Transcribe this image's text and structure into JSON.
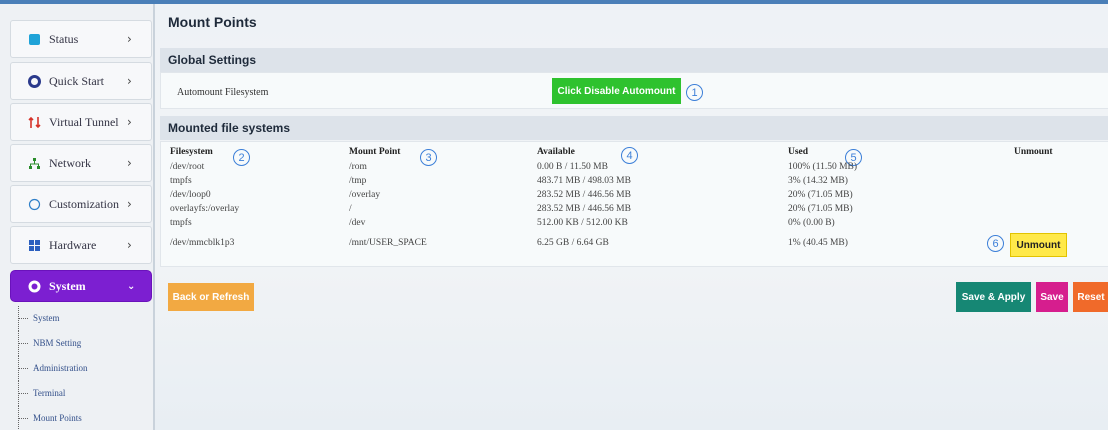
{
  "sidebar": {
    "items": [
      {
        "label": "Status",
        "icon": "status-icon"
      },
      {
        "label": "Quick Start",
        "icon": "gear-icon"
      },
      {
        "label": "Virtual Tunnel",
        "icon": "tunnel-icon"
      },
      {
        "label": "Network",
        "icon": "network-icon"
      },
      {
        "label": "Customization",
        "icon": "customization-icon"
      },
      {
        "label": "Hardware",
        "icon": "hardware-icon"
      },
      {
        "label": "System",
        "icon": "system-gear-icon"
      }
    ],
    "submenu": [
      "System",
      "NBM Setting",
      "Administration",
      "Terminal",
      "Mount Points"
    ]
  },
  "main": {
    "title": "Mount Points",
    "global_settings": {
      "header": "Global Settings",
      "automount_label": "Automount Filesystem",
      "automount_button": "Click Disable Automount"
    },
    "mounted": {
      "header": "Mounted file systems",
      "columns": [
        "Filesystem",
        "Mount Point",
        "Available",
        "Used",
        "Unmount"
      ],
      "rows": [
        [
          "/dev/root",
          "/rom",
          "0.00 B / 11.50 MB",
          "100% (11.50 MB)"
        ],
        [
          "tmpfs",
          "/tmp",
          "483.71 MB / 498.03 MB",
          "3% (14.32 MB)"
        ],
        [
          "/dev/loop0",
          "/overlay",
          "283.52 MB / 446.56 MB",
          "20% (71.05 MB)"
        ],
        [
          "overlayfs:/overlay",
          "/",
          "283.52 MB / 446.56 MB",
          "20% (71.05 MB)"
        ],
        [
          "tmpfs",
          "/dev",
          "512.00 KB / 512.00 KB",
          "0% (0.00 B)"
        ],
        [
          "/dev/mmcblk1p3",
          "/mnt/USER_SPACE",
          "6.25 GB / 6.64 GB",
          "1% (40.45 MB)"
        ]
      ],
      "unmount_button": "Unmount"
    },
    "badges": [
      "1",
      "2",
      "3",
      "4",
      "5",
      "6"
    ],
    "buttons": {
      "back": "Back or Refresh",
      "save_apply": "Save & Apply",
      "save": "Save",
      "reset": "Reset"
    }
  },
  "colors": {
    "active_menu": "#7c1fd1",
    "automount_btn": "#2ec22e",
    "unmount_btn": "#ffe94a",
    "back_btn": "#f2a942",
    "save_apply_btn": "#168774",
    "save_btn": "#d61e8e",
    "reset_btn": "#f06a2a",
    "badge": "#3c7fd8"
  }
}
